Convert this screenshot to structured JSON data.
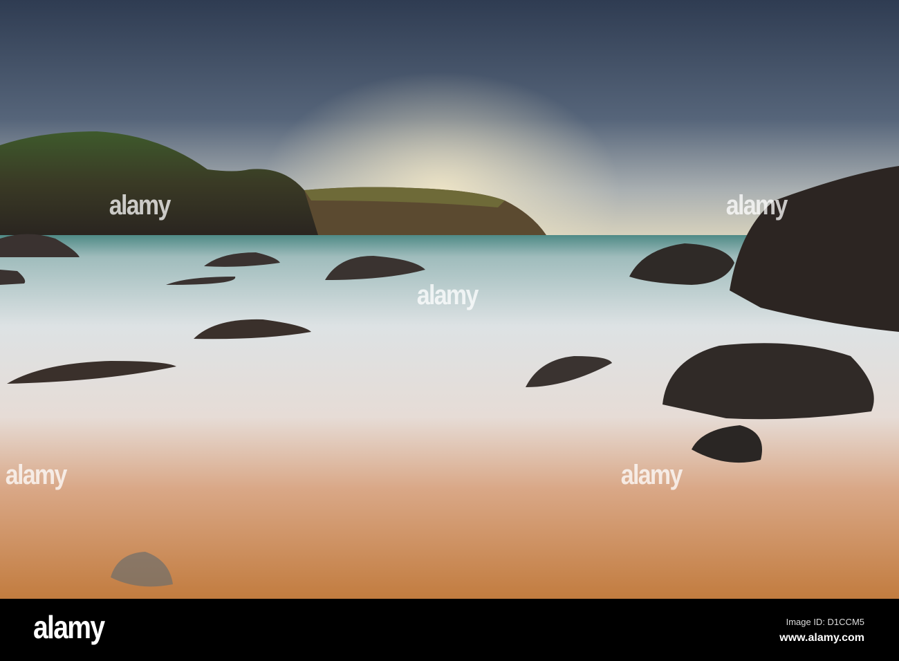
{
  "photo": {
    "description_colors": {
      "sky_top": "#34425a",
      "sky_horizon": "#d8d4c4",
      "sand": "#c9864e",
      "sea": "#4d8a86",
      "foam": "#dfe3e6",
      "rock": "#2a2523"
    }
  },
  "watermark": {
    "text": "alamy"
  },
  "footer": {
    "logo": "alamy",
    "image_id": "Image ID: D1CCM5",
    "site": "www.alamy.com"
  }
}
